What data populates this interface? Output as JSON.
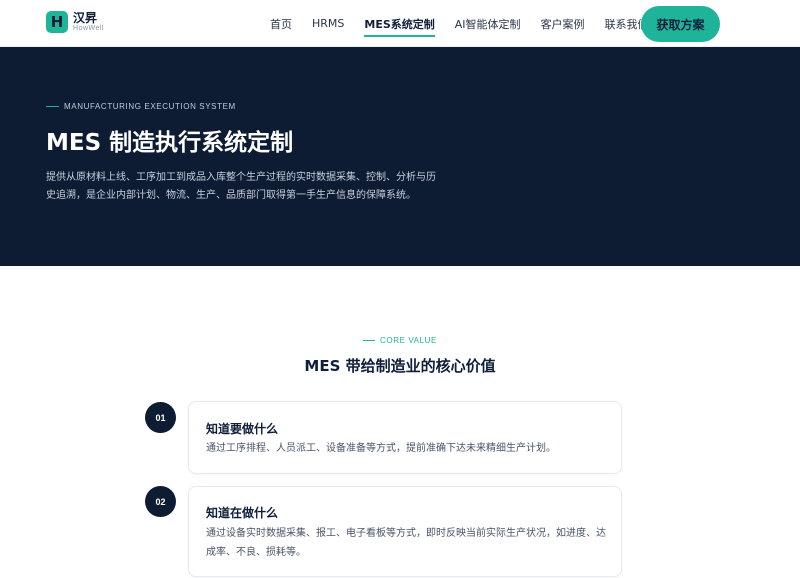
{
  "header": {
    "logo_mark": "H",
    "logo_cn": "汉昇",
    "logo_en": "HowWell",
    "nav": [
      "首页",
      "HRMS",
      "MES系统定制",
      "AI智能体定制",
      "客户案例",
      "联系我们"
    ],
    "active_nav": "MES系统定制",
    "cta_label": "获取方案"
  },
  "hero": {
    "eyebrow": "MANUFACTURING EXECUTION SYSTEM",
    "title": "MES 制造执行系统定制",
    "description": "提供从原材料上线、工序加工到成品入库整个生产过程的实时数据采集、控制、分析与历史追溯，是企业内部计划、物流、生产、品质部门取得第一手生产信息的保障系统。"
  },
  "core": {
    "eyebrow": "CORE VALUE",
    "title": "MES 带给制造业的核心价值",
    "items": [
      {
        "num": "01",
        "title": "知道要做什么",
        "desc": "通过工序排程、人员派工、设备准备等方式，提前准确下达未来精细生产计划。"
      },
      {
        "num": "02",
        "title": "知道在做什么",
        "desc": "通过设备实时数据采集、报工、电子看板等方式，即时反映当前实际生产状况，如进度、达成率、不良、损耗等。"
      }
    ]
  },
  "colors": {
    "accent": "#1fb39a",
    "navy": "#0d1b33"
  }
}
